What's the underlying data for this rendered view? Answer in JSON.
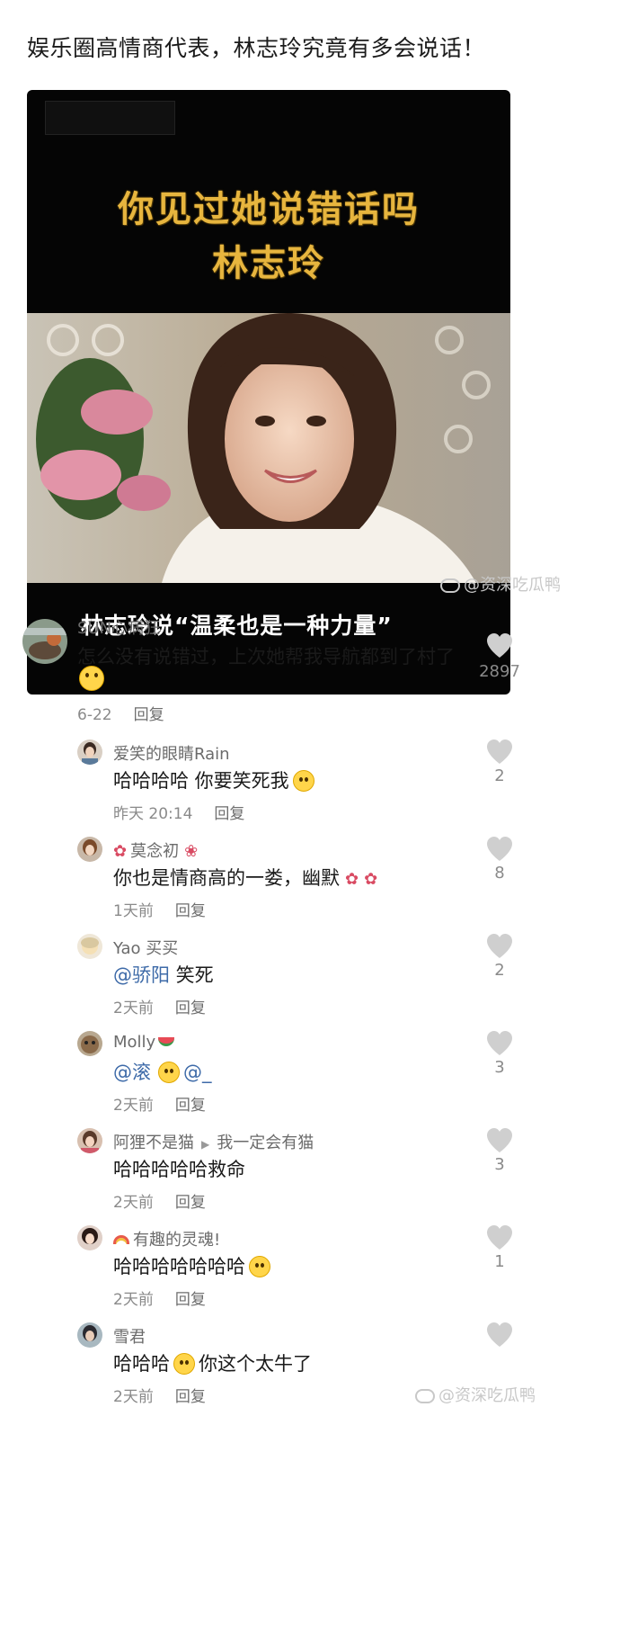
{
  "post": {
    "title": "娱乐圈高情商代表，林志玲究竟有多会说话！",
    "media_headline_1": "你见过她说错话吗",
    "media_headline_2": "林志玲",
    "media_caption": "林志玲说“温柔也是一种力量”",
    "watermark": "@资深吃瓜鸭"
  },
  "comments": [
    {
      "name": "SUN心病狂",
      "text": "怎么没有说错过，上次她帮我导航都到了村了",
      "time": "6-22",
      "reply": "回复",
      "likes": "2897"
    },
    {
      "name": "爱笑的眼睛Rain",
      "text": "哈哈哈哈 你要笑死我",
      "time": "昨天 20:14",
      "reply": "回复",
      "likes": "2"
    },
    {
      "name": "莫念初",
      "text": "你也是情商高的一娄，幽默",
      "time": "1天前",
      "reply": "回复",
      "likes": "8"
    },
    {
      "name": "Yao 买买",
      "mention": "@骄阳",
      "text": " 笑死",
      "time": "2天前",
      "reply": "回复",
      "likes": "2"
    },
    {
      "name": "Molly",
      "mention": "@滚",
      "text2": "@_",
      "time": "2天前",
      "reply": "回复",
      "likes": "3"
    },
    {
      "name": "阿狸不是猫",
      "reply_to": "我一定会有猫",
      "text": "哈哈哈哈哈救命",
      "time": "2天前",
      "reply": "回复",
      "likes": "3"
    },
    {
      "name": "有趣的灵魂!",
      "text": "哈哈哈哈哈哈哈",
      "time": "2天前",
      "reply": "回复",
      "likes": "1"
    },
    {
      "name": "雪君",
      "text": "哈哈哈",
      "text2": "你这个太牛了",
      "time": "2天前",
      "reply": "回复",
      "likes": ""
    }
  ],
  "colors": {
    "accent_gold": "#e7b53e",
    "mention_blue": "#3d6aa8",
    "muted": "#8a8a8a"
  },
  "icons": {
    "like": "heart-icon",
    "emoji": "laugh-emoji-icon",
    "arrow": "reply-arrow-icon"
  }
}
